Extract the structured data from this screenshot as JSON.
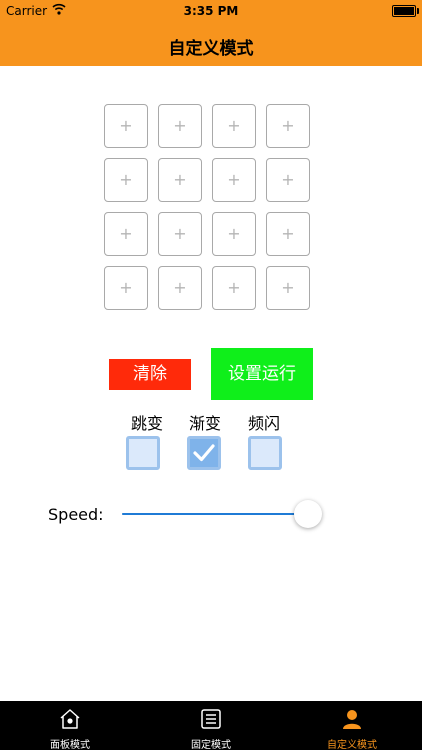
{
  "status_bar": {
    "carrier": "Carrier",
    "time": "3:35 PM",
    "battery_level": 1.0
  },
  "nav": {
    "title": "自定义模式"
  },
  "grid": {
    "rows": 4,
    "cols": 4,
    "cell_symbol": "+"
  },
  "buttons": {
    "clear_label": "清除",
    "run_label": "设置运行"
  },
  "colors": {
    "accent": "#f7941d",
    "clear": "#ff2a0a",
    "run": "#0fef1a",
    "slider": "#1f7bd6",
    "tab_active": "#f7941d",
    "tab_inactive": "#ffffff"
  },
  "modes": [
    {
      "label": "跳变",
      "checked": false
    },
    {
      "label": "渐变",
      "checked": true
    },
    {
      "label": "频闪",
      "checked": false
    }
  ],
  "speed": {
    "label": "Speed:",
    "value": 1.0
  },
  "tabs": [
    {
      "label": "面板模式",
      "icon": "home-icon",
      "active": false
    },
    {
      "label": "固定模式",
      "icon": "list-icon",
      "active": false
    },
    {
      "label": "自定义模式",
      "icon": "person-icon",
      "active": true
    }
  ]
}
